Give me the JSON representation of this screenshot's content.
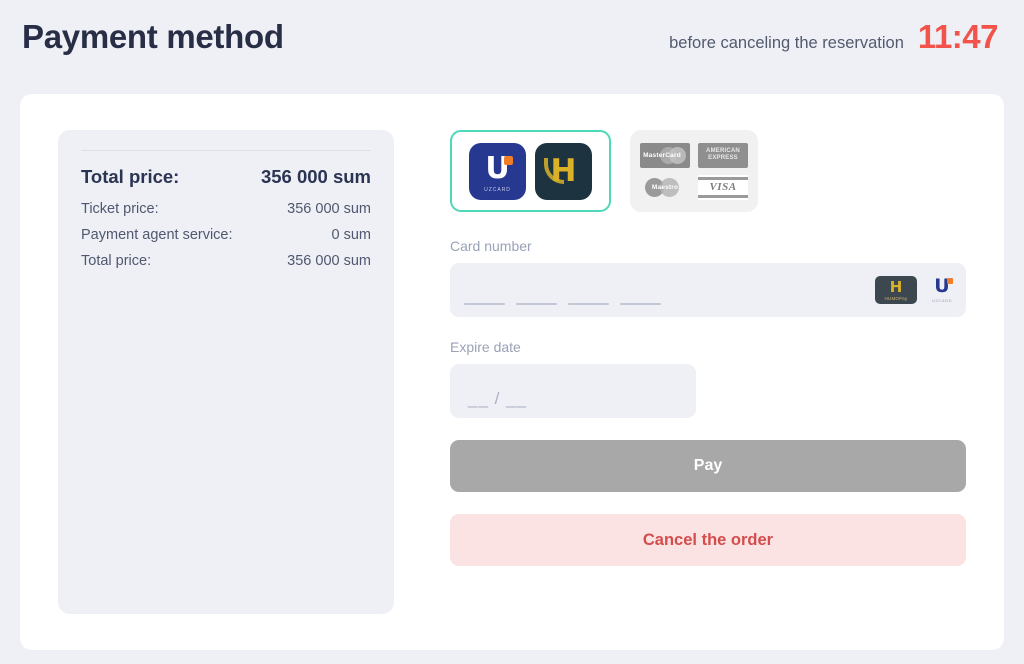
{
  "header": {
    "title": "Payment method",
    "timer_label": "before canceling the reservation",
    "timer_value": "11:47",
    "timer_color": "#f2544b"
  },
  "summary": {
    "rows": [
      {
        "label": "Total price:",
        "value": "356 000 sum"
      },
      {
        "label": "Ticket price:",
        "value": "356 000 sum"
      },
      {
        "label": "Payment agent service:",
        "value": "0 sum"
      },
      {
        "label": "Total price:",
        "value": "356 000 sum"
      }
    ]
  },
  "payment_methods": {
    "selected_index": 0,
    "selected_border_color": "#4fd8ba",
    "local": {
      "name": "local-cards",
      "logos": [
        {
          "name": "uzcard-logo",
          "glyph": "U",
          "wordmark": "UZCARD",
          "bg": "#26388f"
        },
        {
          "name": "humo-logo",
          "glyph": "H",
          "bg": "#1d3340",
          "accent": "#d9b228"
        }
      ]
    },
    "international": {
      "name": "international-cards",
      "brands": [
        {
          "name": "mastercard-logo",
          "label": "MasterCard"
        },
        {
          "name": "amex-logo",
          "line1": "AMERICAN",
          "line2": "EXPRESS"
        },
        {
          "name": "maestro-logo",
          "label": "Maestro"
        },
        {
          "name": "visa-logo",
          "label": "VISA"
        }
      ]
    }
  },
  "form": {
    "card_number": {
      "label": "Card number",
      "value": "",
      "placeholder": "____ ____ ____ ____",
      "icons": [
        {
          "name": "humo-pay-icon",
          "glyph": "H",
          "text": "HUMOPay"
        },
        {
          "name": "uzcard-icon",
          "glyph": "U",
          "text": "UZCARD"
        }
      ]
    },
    "expire_date": {
      "label": "Expire date",
      "value": "",
      "placeholder": "__ / __"
    }
  },
  "actions": {
    "pay_label": "Pay",
    "pay_bg": "#a8a8a8",
    "cancel_label": "Cancel the order",
    "cancel_bg": "#fbe3e3",
    "cancel_color": "#d34d4d"
  }
}
